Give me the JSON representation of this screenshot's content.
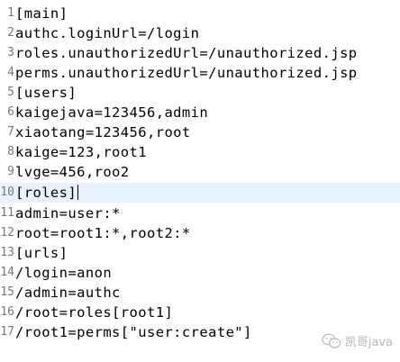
{
  "editor": {
    "current_line": 10,
    "lines": [
      {
        "num": "1",
        "text": "[main]"
      },
      {
        "num": "2",
        "text": "authc.loginUrl=/login"
      },
      {
        "num": "3",
        "text": "roles.unauthorizedUrl=/unauthorized.jsp"
      },
      {
        "num": "4",
        "text": "perms.unauthorizedUrl=/unauthorized.jsp"
      },
      {
        "num": "5",
        "text": "[users]"
      },
      {
        "num": "6",
        "text": "kaigejava=123456,admin"
      },
      {
        "num": "7",
        "text": "xiaotang=123456,root"
      },
      {
        "num": "8",
        "text": "kaige=123,root1"
      },
      {
        "num": "9",
        "text": "lvge=456,roo2"
      },
      {
        "num": "10",
        "text": "[roles]"
      },
      {
        "num": "11",
        "text": "admin=user:*"
      },
      {
        "num": "12",
        "text": "root=root1:*,root2:*"
      },
      {
        "num": "13",
        "text": "[urls]"
      },
      {
        "num": "14",
        "text": "/login=anon"
      },
      {
        "num": "15",
        "text": "/admin=authc"
      },
      {
        "num": "16",
        "text": "/root=roles[root1]"
      },
      {
        "num": "17",
        "text": "/root1=perms[\"user:create\"]"
      }
    ]
  },
  "watermark": {
    "icon": "wechat-icon",
    "text": "凯哥java"
  }
}
